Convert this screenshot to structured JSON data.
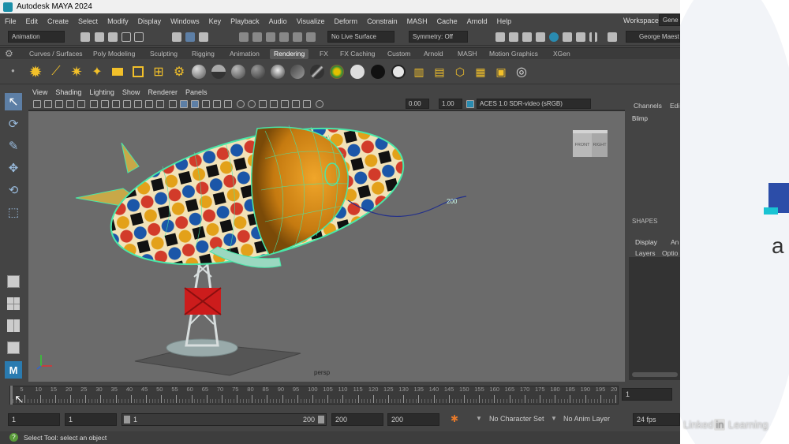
{
  "app": {
    "title": "Autodesk MAYA 2024"
  },
  "menus": [
    "File",
    "Edit",
    "Create",
    "Select",
    "Modify",
    "Display",
    "Windows",
    "Key",
    "Playback",
    "Audio",
    "Visualize",
    "Deform",
    "Constrain",
    "MASH",
    "Cache",
    "Arnold",
    "Help"
  ],
  "status": {
    "mode": "Animation",
    "live_surface": "No Live Surface",
    "symmetry": "Symmetry: Off",
    "workspace_label": "Workspace:",
    "workspace_value": "Gene",
    "user": "George Maest"
  },
  "shelf": {
    "tabs": [
      "Curves / Surfaces",
      "Poly Modeling",
      "Sculpting",
      "Rigging",
      "Animation",
      "Rendering",
      "FX",
      "FX Caching",
      "Custom",
      "Arnold",
      "MASH",
      "Motion Graphics",
      "XGen"
    ],
    "active": "Rendering"
  },
  "viewport": {
    "menus": [
      "View",
      "Shading",
      "Lighting",
      "Show",
      "Renderer",
      "Panels"
    ],
    "near": "0.00",
    "far": "1.00",
    "colorspace": "ACES 1.0 SDR-video (sRGB)",
    "camera": "persp",
    "cube_front": "FRONT",
    "cube_right": "RIGHT",
    "path_label": "200"
  },
  "channel_box": {
    "tabs": [
      "Channels",
      "Edi"
    ],
    "object": "Blimp",
    "shapes": "SHAPES",
    "layer_tabs": [
      "Display",
      "An"
    ],
    "layer_menus": [
      "Layers",
      "Optio"
    ]
  },
  "timeline": {
    "ticks": [
      "5",
      "10",
      "15",
      "20",
      "25",
      "30",
      "35",
      "40",
      "45",
      "50",
      "55",
      "60",
      "65",
      "70",
      "75",
      "80",
      "85",
      "90",
      "95",
      "100",
      "105",
      "110",
      "115",
      "120",
      "125",
      "130",
      "135",
      "140",
      "145",
      "150",
      "155",
      "160",
      "165",
      "170",
      "175",
      "180",
      "185",
      "190",
      "195",
      "20"
    ],
    "current_frame": "1"
  },
  "range": {
    "start": "1",
    "playback_start": "1",
    "slider_left": "1",
    "slider_right": "200",
    "playback_end": "200",
    "end": "200",
    "character_set": "No Character Set",
    "anim_layer": "No Anim Layer",
    "fps": "24 fps"
  },
  "help_line": "Select Tool: select an object",
  "slide": {
    "letter": "a",
    "watermark": "Linked",
    "watermark_box": "in",
    "watermark_tail": " Learning"
  },
  "colors": {
    "accent": "#1c8fa8",
    "active_tab": "#5a5a5a",
    "viewport_bg": "#6b6b6b"
  }
}
